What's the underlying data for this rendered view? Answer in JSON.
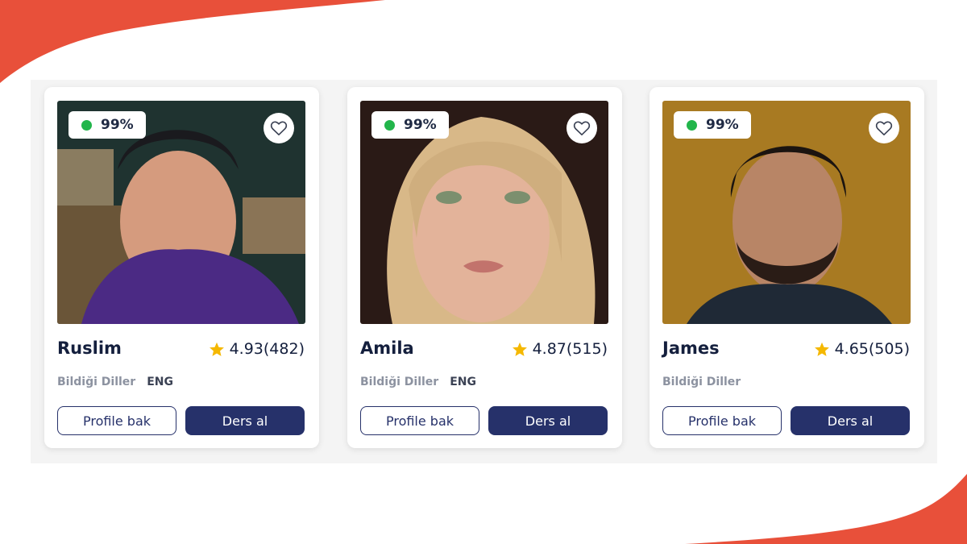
{
  "theme": {
    "accent": "#e8503a",
    "navy": "#26316a",
    "online": "#22b54b",
    "star": "#f5b800"
  },
  "tutors": [
    {
      "name": "Ruslim",
      "online_pct": "99%",
      "rating": "4.93(482)",
      "languages_label": "Bildiği Diller",
      "languages": "ENG",
      "profile_label": "Profile bak",
      "book_label": "Ders al",
      "favorite_icon": "heart-outline-icon"
    },
    {
      "name": "Amila",
      "online_pct": "99%",
      "rating": "4.87(515)",
      "languages_label": "Bildiği Diller",
      "languages": "ENG",
      "profile_label": "Profile bak",
      "book_label": "Ders al",
      "favorite_icon": "heart-outline-icon"
    },
    {
      "name": "James",
      "online_pct": "99%",
      "rating": "4.65(505)",
      "languages_label": "Bildiği Diller",
      "languages": "",
      "profile_label": "Profile bak",
      "book_label": "Ders al",
      "favorite_icon": "heart-outline-icon"
    }
  ]
}
